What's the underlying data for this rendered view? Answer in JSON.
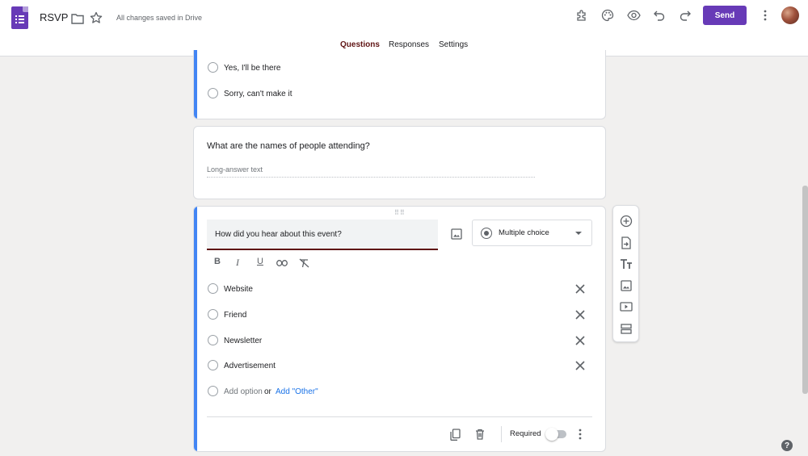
{
  "header": {
    "title": "RSVP",
    "saved_status": "All changes saved in Drive",
    "send_label": "Send",
    "icons": [
      "forms-logo-icon",
      "folder-icon",
      "star-icon",
      "addon-puzzle-icon",
      "palette-icon",
      "eye-preview-icon",
      "undo-icon",
      "redo-icon",
      "more-vert-icon",
      "avatar"
    ]
  },
  "tabs": [
    {
      "label": "Questions",
      "active": true
    },
    {
      "label": "Responses",
      "active": false
    },
    {
      "label": "Settings",
      "active": false
    }
  ],
  "questions": {
    "q1": {
      "options": [
        "Yes,  I'll be there",
        "Sorry, can't make it"
      ]
    },
    "q2": {
      "title": "What are the names of people attending?",
      "answer_placeholder": "Long-answer text"
    },
    "q3": {
      "title": "How did you hear about this event?",
      "type": "Multiple choice",
      "options": [
        "Website",
        "Friend",
        "Newsletter",
        "Advertisement"
      ],
      "add_option": "Add option",
      "or": "or",
      "add_other": "Add \"Other\"",
      "required_label": "Required",
      "required": false
    }
  },
  "side_toolbar": [
    "add-question-icon",
    "import-questions-icon",
    "add-title-icon",
    "add-image-icon",
    "add-video-icon",
    "add-section-icon"
  ],
  "colors": {
    "brand": "#673ab7",
    "accent_blue": "#4285f4",
    "active_tab": "#5f1414"
  }
}
